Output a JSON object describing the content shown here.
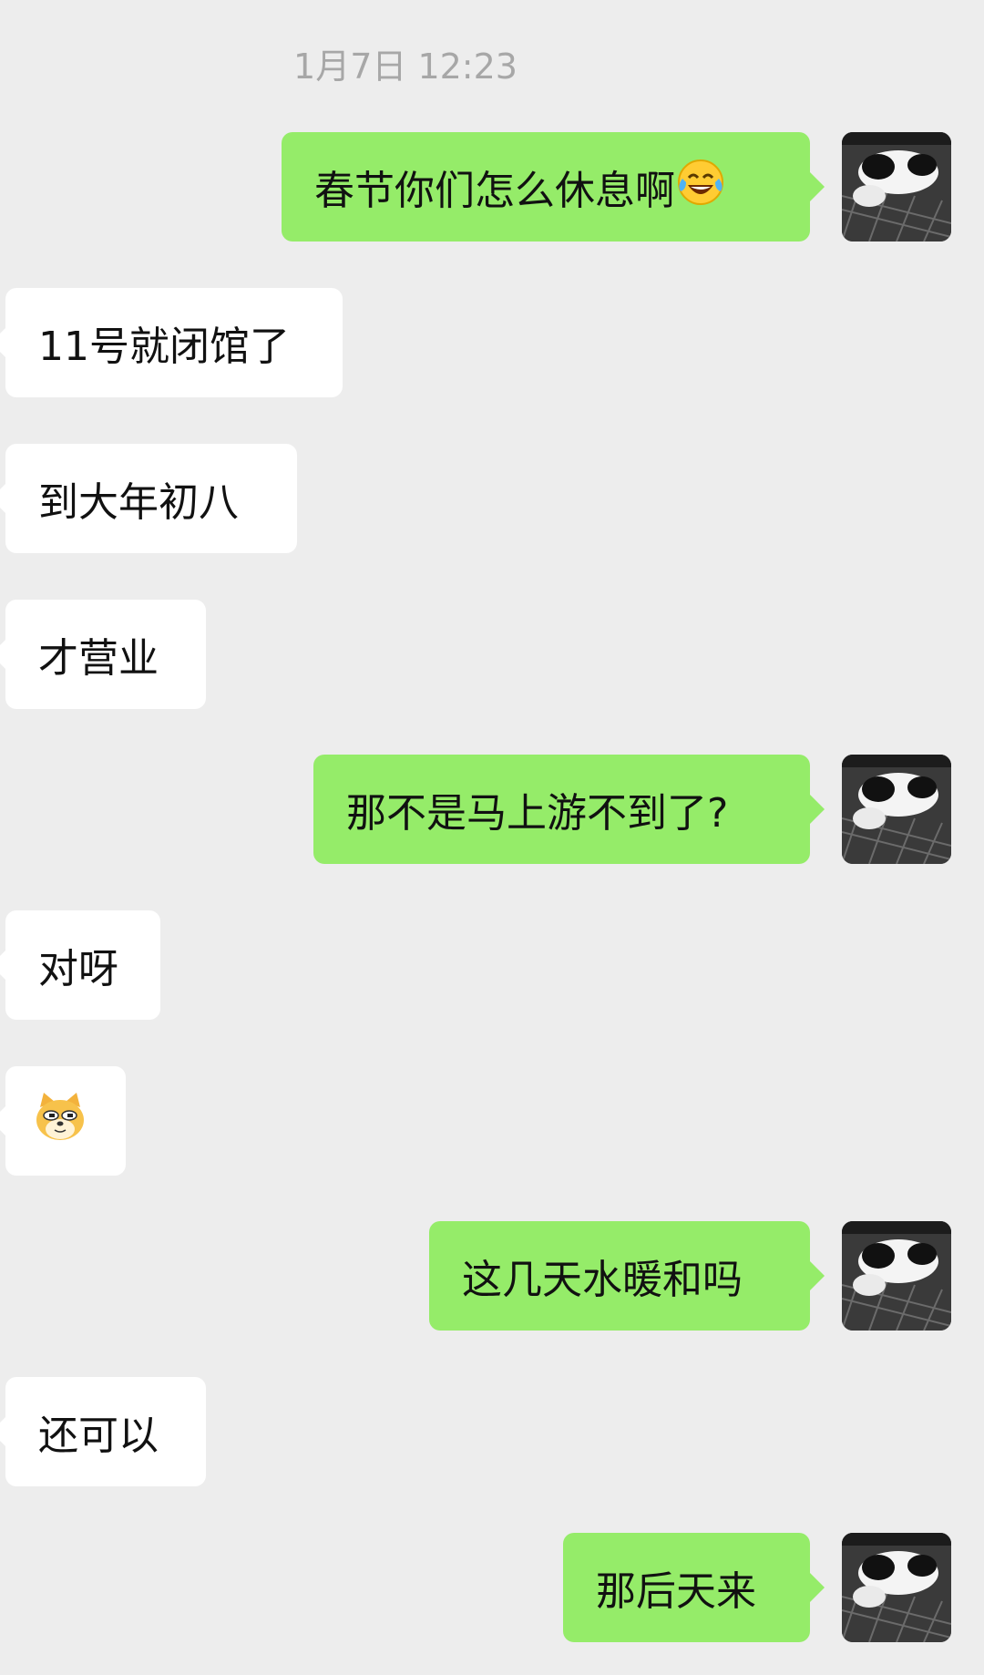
{
  "timestamp": "1月7日 12:23",
  "messages": [
    {
      "side": "out",
      "text": "春节你们怎么休息啊",
      "emoji": "tears-of-joy-emoji"
    },
    {
      "side": "in",
      "text": "11号就闭馆了"
    },
    {
      "side": "in",
      "text": "到大年初八"
    },
    {
      "side": "in",
      "text": "才营业"
    },
    {
      "side": "out",
      "text": "那不是马上游不到了?"
    },
    {
      "side": "in",
      "text": "对呀"
    },
    {
      "side": "in",
      "text": "",
      "emoji": "doge-emoji"
    },
    {
      "side": "out",
      "text": "这几天水暖和吗"
    },
    {
      "side": "in",
      "text": "还可以"
    },
    {
      "side": "out",
      "text": "那后天来"
    }
  ],
  "avatar": {
    "icon": "cat-avatar-photo"
  },
  "colors": {
    "background": "#EDEDED",
    "outgoing_bubble": "#95EC69",
    "incoming_bubble": "#FFFFFF"
  }
}
